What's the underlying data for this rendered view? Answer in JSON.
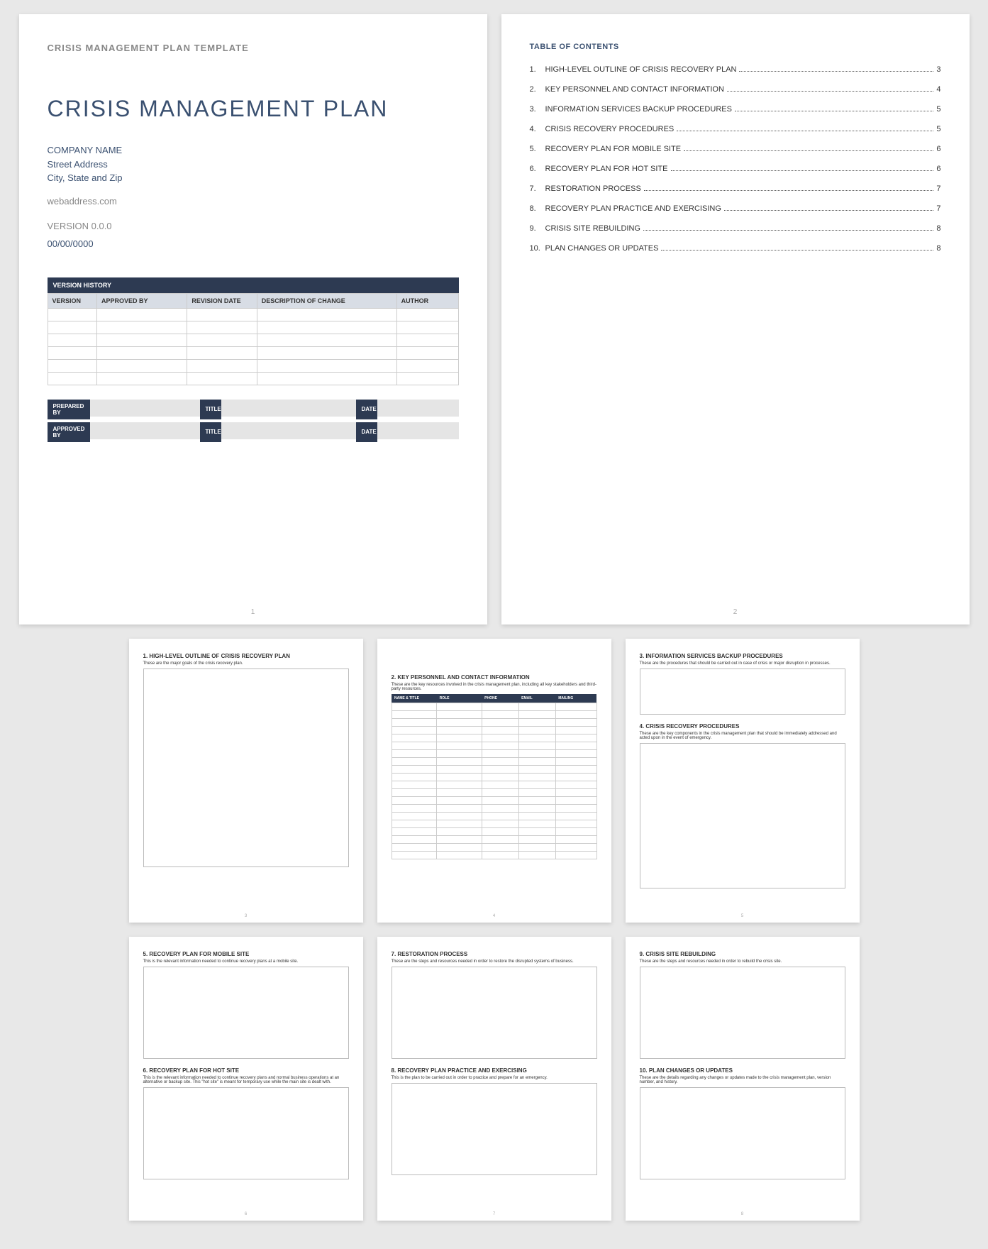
{
  "page1": {
    "templateHeader": "CRISIS MANAGEMENT PLAN TEMPLATE",
    "title": "CRISIS MANAGEMENT PLAN",
    "companyName": "COMPANY NAME",
    "street": "Street Address",
    "cityState": "City, State and Zip",
    "webAddress": "webaddress.com",
    "version": "VERSION 0.0.0",
    "date": "00/00/0000",
    "versionHistoryHeader": "VERSION HISTORY",
    "vhCols": {
      "c1": "VERSION",
      "c2": "APPROVED BY",
      "c3": "REVISION DATE",
      "c4": "DESCRIPTION OF CHANGE",
      "c5": "AUTHOR"
    },
    "approval": {
      "preparedBy": "PREPARED BY",
      "approvedBy": "APPROVED BY",
      "title": "TITLE",
      "date": "DATE"
    },
    "pageNum": "1"
  },
  "page2": {
    "tocTitle": "TABLE OF CONTENTS",
    "items": [
      {
        "num": "1.",
        "text": "HIGH-LEVEL OUTLINE OF CRISIS RECOVERY PLAN",
        "page": "3"
      },
      {
        "num": "2.",
        "text": "KEY PERSONNEL AND CONTACT INFORMATION",
        "page": "4"
      },
      {
        "num": "3.",
        "text": "INFORMATION SERVICES BACKUP PROCEDURES",
        "page": "5"
      },
      {
        "num": "4.",
        "text": "CRISIS RECOVERY PROCEDURES",
        "page": "5"
      },
      {
        "num": "5.",
        "text": "RECOVERY PLAN FOR MOBILE SITE",
        "page": "6"
      },
      {
        "num": "6.",
        "text": "RECOVERY PLAN FOR HOT SITE",
        "page": "6"
      },
      {
        "num": "7.",
        "text": "RESTORATION PROCESS",
        "page": "7"
      },
      {
        "num": "8.",
        "text": "RECOVERY PLAN PRACTICE AND EXERCISING",
        "page": "7"
      },
      {
        "num": "9.",
        "text": "CRISIS SITE REBUILDING",
        "page": "8"
      },
      {
        "num": "10.",
        "text": "PLAN CHANGES OR UPDATES",
        "page": "8"
      }
    ],
    "pageNum": "2"
  },
  "page3": {
    "s1title": "1.   HIGH-LEVEL OUTLINE OF CRISIS RECOVERY PLAN",
    "s1desc": "These are the major goals of the crisis recovery plan.",
    "pageNum": "3"
  },
  "page4": {
    "s2title": "2.   KEY PERSONNEL AND CONTACT INFORMATION",
    "s2desc": "These are the key resources involved in the crisis management plan, including all key stakeholders and third-party resources.",
    "cols": {
      "c1": "NAME & TITLE",
      "c2": "ROLE",
      "c3": "PHONE",
      "c4": "EMAIL",
      "c5": "MAILING"
    },
    "pageNum": "4"
  },
  "page5": {
    "s3title": "3.   INFORMATION SERVICES BACKUP PROCEDURES",
    "s3desc": "These are the procedures that should be carried out in case of crisis or major disruption in processes.",
    "s4title": "4.   CRISIS RECOVERY PROCEDURES",
    "s4desc": "These are the key components in the crisis management plan that should be immediately addressed and acted upon in the event of emergency.",
    "pageNum": "5"
  },
  "page6": {
    "s5title": "5.   RECOVERY PLAN FOR MOBILE SITE",
    "s5desc": "This is the relevant information needed to continue recovery plans at a mobile site.",
    "s6title": "6.   RECOVERY PLAN FOR HOT SITE",
    "s6desc": "This is the relevant information needed to continue recovery plans and normal business operations at an alternative or backup site. This \"hot site\" is meant for temporary use while the main site is dealt with.",
    "pageNum": "6"
  },
  "page7": {
    "s7title": "7.   RESTORATION PROCESS",
    "s7desc": "These are the steps and resources needed in order to restore the disrupted systems of business.",
    "s8title": "8.   RECOVERY PLAN PRACTICE AND EXERCISING",
    "s8desc": "This is the plan to be carried out in order to practice and prepare for an emergency.",
    "pageNum": "7"
  },
  "page8": {
    "s9title": "9.   CRISIS SITE REBUILDING",
    "s9desc": "These are the steps and resources needed in order to rebuild the crisis site.",
    "s10title": "10.    PLAN CHANGES OR UPDATES",
    "s10desc": "These are the details regarding any changes or updates made to the crisis management plan, version number, and history.",
    "pageNum": "8"
  }
}
